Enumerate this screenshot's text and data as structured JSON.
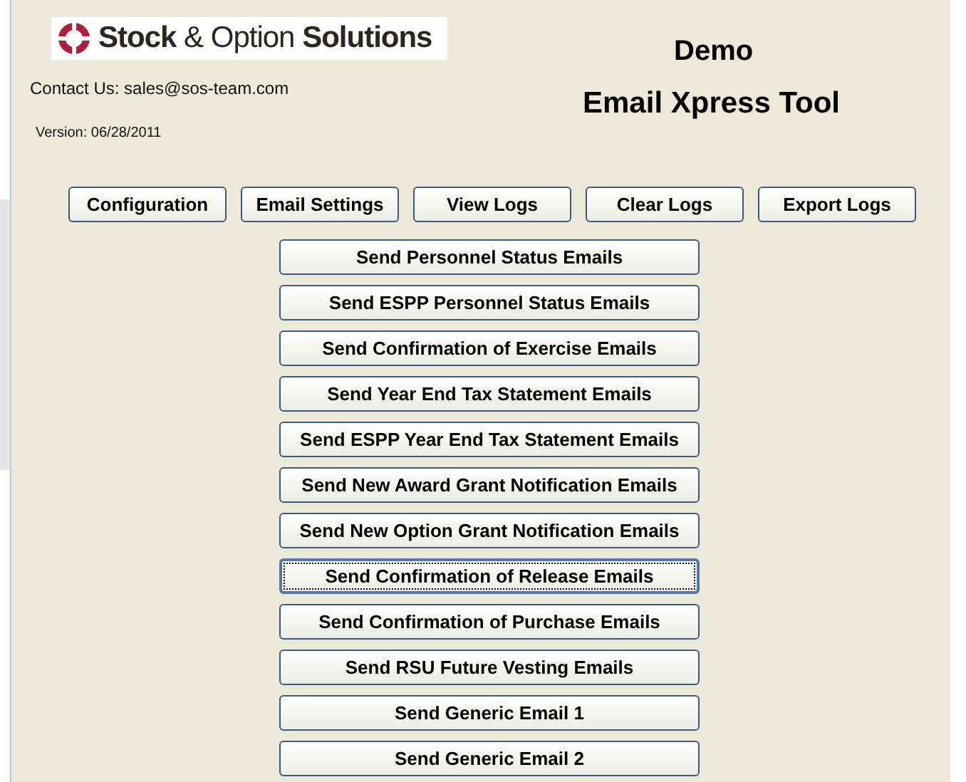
{
  "logo": {
    "text": "**Stock** & Option **Solutions**"
  },
  "contact": "Contact Us: sales@sos-team.com",
  "version": "Version: 06/28/2011",
  "title": [
    "Demo",
    "Email Xpress Tool"
  ],
  "toolbar_buttons": [
    "Configuration",
    "Email Settings",
    "View Logs",
    "Clear Logs",
    "Export Logs"
  ],
  "send_buttons": [
    {
      "label": "Send Personnel Status Emails",
      "focused": false
    },
    {
      "label": "Send ESPP Personnel Status Emails",
      "focused": false
    },
    {
      "label": "Send Confirmation of Exercise Emails",
      "focused": false
    },
    {
      "label": "Send Year End Tax Statement Emails",
      "focused": false
    },
    {
      "label": "Send ESPP Year End Tax Statement Emails",
      "focused": false
    },
    {
      "label": "Send New Award Grant Notification Emails",
      "focused": false
    },
    {
      "label": "Send New Option Grant Notification Emails",
      "focused": false
    },
    {
      "label": "Send Confirmation of Release Emails",
      "focused": true
    },
    {
      "label": "Send Confirmation of Purchase Emails",
      "focused": false
    },
    {
      "label": "Send RSU Future Vesting Emails",
      "focused": false
    },
    {
      "label": "Send Generic Email 1",
      "focused": false
    },
    {
      "label": "Send Generic Email 2",
      "focused": false
    }
  ]
}
